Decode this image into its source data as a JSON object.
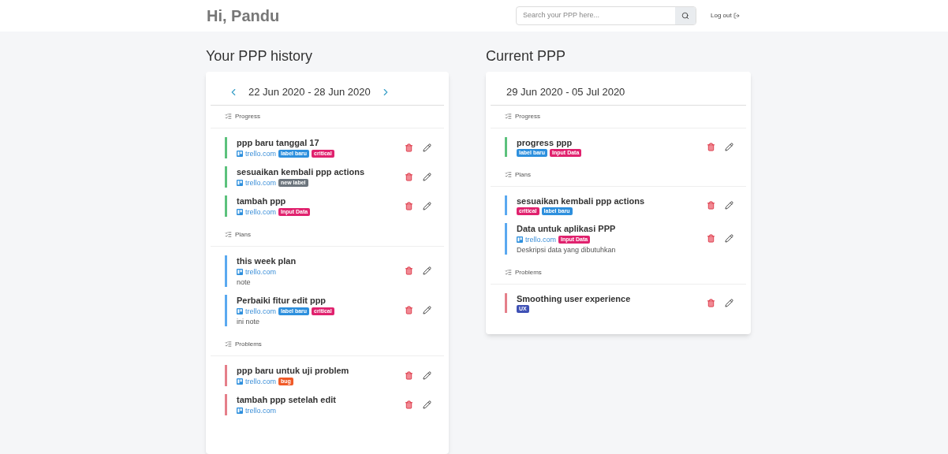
{
  "header": {
    "greeting": "Hi, Pandu",
    "search": {
      "placeholder": "Search your PPP here..."
    },
    "logout": "Log out"
  },
  "columns": [
    {
      "title": "Your PPP history",
      "range": "22 Jun 2020 - 28 Jun 2020",
      "navigable": true,
      "sections": [
        {
          "kind": "progress",
          "title": "Progress",
          "items": [
            {
              "title": "ppp baru tanggal 17",
              "link": "trello.com",
              "labels": [
                {
                  "text": "label baru",
                  "color": "#2d8fdd"
                },
                {
                  "text": "critical",
                  "color": "#e0226e"
                }
              ]
            },
            {
              "title": "sesuaikan kembali ppp actions",
              "link": "trello.com",
              "labels": [
                {
                  "text": "new label",
                  "color": "#6c757d"
                }
              ]
            },
            {
              "title": "tambah ppp",
              "link": "trello.com",
              "labels": [
                {
                  "text": "Input Data",
                  "color": "#e0226e"
                }
              ]
            }
          ]
        },
        {
          "kind": "plans",
          "title": "Plans",
          "items": [
            {
              "title": "this week plan",
              "link": "trello.com",
              "note": "note"
            },
            {
              "title": "Perbaiki fitur edit ppp",
              "link": "trello.com",
              "labels": [
                {
                  "text": "label baru",
                  "color": "#2d8fdd"
                },
                {
                  "text": "critical",
                  "color": "#e0226e"
                }
              ],
              "note": "ini note"
            }
          ]
        },
        {
          "kind": "problems",
          "title": "Problems",
          "items": [
            {
              "title": "ppp baru untuk uji problem",
              "link": "trello.com",
              "labels": [
                {
                  "text": "bug",
                  "color": "#f05a28"
                }
              ]
            },
            {
              "title": "tambah ppp setelah edit",
              "link": "trello.com"
            }
          ]
        }
      ]
    },
    {
      "title": "Current PPP",
      "range": "29 Jun 2020 - 05 Jul 2020",
      "navigable": false,
      "sections": [
        {
          "kind": "progress",
          "title": "Progress",
          "items": [
            {
              "title": "progress ppp",
              "labels": [
                {
                  "text": "label baru",
                  "color": "#2d8fdd"
                },
                {
                  "text": "Input Data",
                  "color": "#e0226e"
                }
              ]
            }
          ]
        },
        {
          "kind": "plans",
          "title": "Plans",
          "items": [
            {
              "title": "sesuaikan kembali ppp actions",
              "labels": [
                {
                  "text": "critical",
                  "color": "#e0226e"
                },
                {
                  "text": "label baru",
                  "color": "#2d8fdd"
                }
              ]
            },
            {
              "title": "Data untuk aplikasi PPP",
              "link": "trello.com",
              "labels": [
                {
                  "text": "Input Data",
                  "color": "#e0226e"
                }
              ],
              "note": "Deskripsi data yang dibutuhkan"
            }
          ]
        },
        {
          "kind": "problems",
          "title": "Problems",
          "items": [
            {
              "title": "Smoothing user experience",
              "labels": [
                {
                  "text": "UX",
                  "color": "#3f51b5"
                }
              ]
            }
          ]
        }
      ]
    }
  ]
}
